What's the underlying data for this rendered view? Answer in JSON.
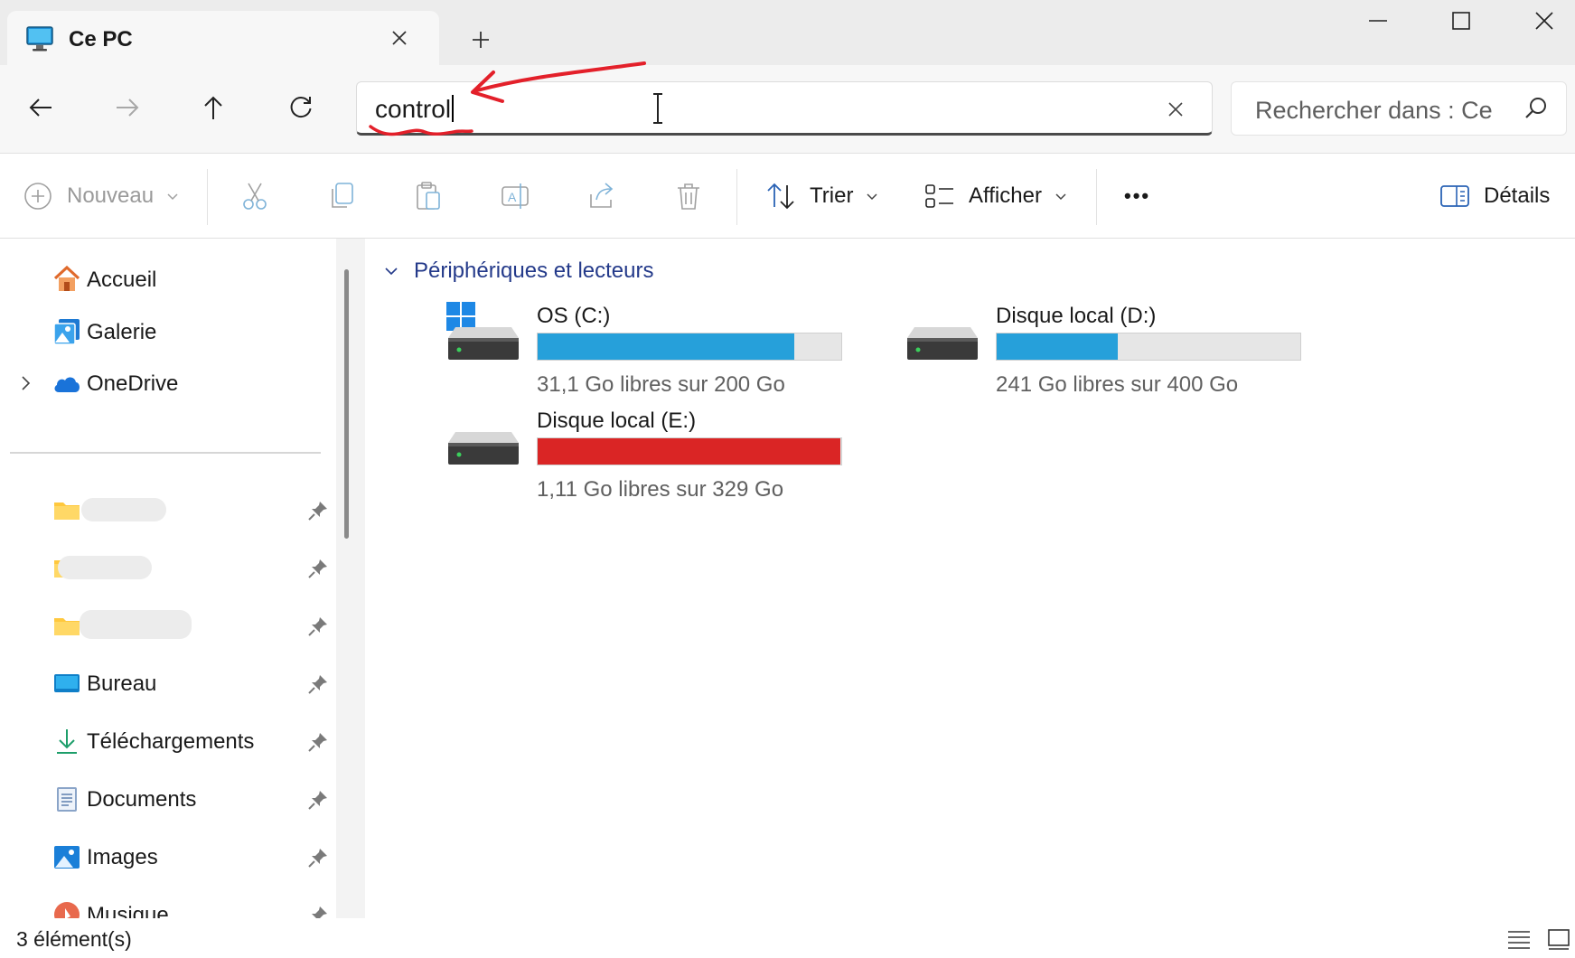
{
  "tab": {
    "title": "Ce PC",
    "icon": "this-pc-monitor-icon"
  },
  "address": {
    "value": "control",
    "clear_icon": "close-icon"
  },
  "search": {
    "placeholder": "Rechercher dans : Ce PC"
  },
  "toolbar": {
    "new_label": "Nouveau",
    "sort_label": "Trier",
    "view_label": "Afficher",
    "more_label": "•••",
    "details_label": "Détails"
  },
  "sidebar": {
    "top_items": [
      {
        "label": "Accueil",
        "icon": "home-icon"
      },
      {
        "label": "Galerie",
        "icon": "gallery-icon"
      },
      {
        "label": "OneDrive",
        "icon": "onedrive-cloud-icon"
      }
    ],
    "pinned": [
      {
        "label": "Bureau",
        "icon": "desktop-folder-icon"
      },
      {
        "label": "Téléchargements",
        "icon": "downloads-icon"
      },
      {
        "label": "Documents",
        "icon": "documents-icon"
      },
      {
        "label": "Images",
        "icon": "pictures-icon"
      },
      {
        "label": "Musique",
        "icon": "music-icon"
      }
    ]
  },
  "content": {
    "group_title": "Périphériques et lecteurs",
    "drives": [
      {
        "name": "OS (C:)",
        "free_text": "31,1 Go libres sur 200 Go",
        "used_fraction": 0.8445,
        "bar_color": "#26a0da"
      },
      {
        "name": "Disque local (D:)",
        "free_text": "241 Go libres sur 400 Go",
        "used_fraction": 0.3975,
        "bar_color": "#26a0da"
      },
      {
        "name": "Disque local (E:)",
        "free_text": "1,11 Go libres sur 329 Go",
        "used_fraction": 0.9966,
        "bar_color": "#da2525"
      }
    ]
  },
  "status": {
    "count_text": "3 élément(s)"
  },
  "colors": {
    "accent": "#0067c0",
    "annotation_red": "#e3202a"
  }
}
